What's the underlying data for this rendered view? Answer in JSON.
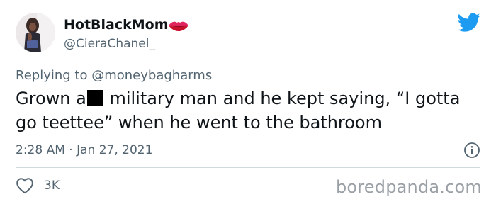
{
  "user": {
    "display_name": "HotBlackMom",
    "handle": "@CieraChanel_",
    "name_emoji_icon": "kiss-mark-icon"
  },
  "reply": {
    "prefix": "Replying to",
    "mention": "@moneybagharms"
  },
  "tweet": {
    "text_part1": "Grown a",
    "text_part2": "military man and he kept saying, “I gotta go teettee” when he went to the bathroom"
  },
  "meta": {
    "timestamp": "2:28 AM · Jan 27, 2021"
  },
  "actions": {
    "like_count": "3K"
  },
  "watermark": "boredpanda.com",
  "colors": {
    "twitter_blue": "#1d9bf0",
    "secondary_text": "#536471",
    "lips_red": "#e0245e"
  }
}
